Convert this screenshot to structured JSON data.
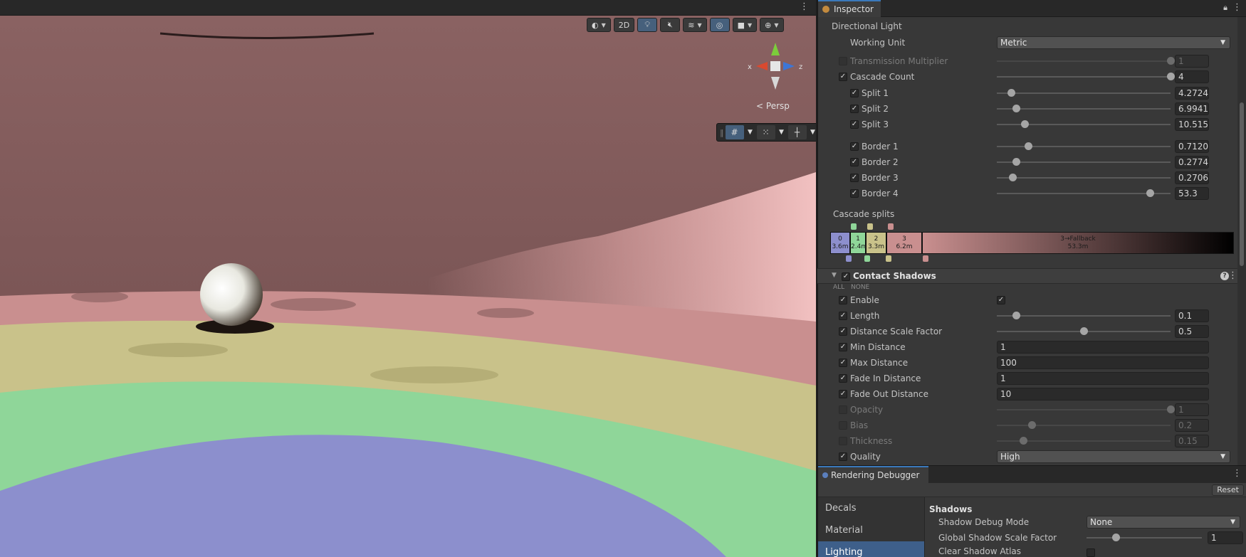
{
  "scene": {
    "toolbar": {
      "draw_mode_icon": "shading-sphere-icon",
      "mode_2d": "2D",
      "lighting_icon": "bulb-icon",
      "audio_icon": "audio-mute-icon",
      "effects_icon": "layers-icon",
      "visibility_icon": "eye-hidden-icon",
      "camera_icon": "camera-icon",
      "gizmos_icon": "globe-icon"
    },
    "gizmo": {
      "x_label": "x",
      "z_label": "z"
    },
    "persp_label": "Persp",
    "colors": {
      "red_band": "#c98f8f",
      "yellow_band": "#c9c28a",
      "green_band": "#8fd699",
      "blue_band": "#8c8fcd"
    }
  },
  "inspector": {
    "tab_title": "Inspector",
    "section_title": "Directional Light",
    "working_unit": {
      "label": "Working Unit",
      "value": "Metric"
    },
    "transmission_multiplier": {
      "label": "Transmission  Multiplier",
      "value": "1",
      "fraction": 1.0
    },
    "cascade_count": {
      "label": "Cascade Count",
      "value": "4",
      "fraction": 1.0
    },
    "splits": [
      {
        "label": "Split 1",
        "value": "4.2724",
        "fraction": 0.08
      },
      {
        "label": "Split 2",
        "value": "6.99419",
        "fraction": 0.11
      },
      {
        "label": "Split 3",
        "value": "10.5154",
        "fraction": 0.16
      }
    ],
    "borders": [
      {
        "label": "Border 1",
        "value": "0.71206",
        "fraction": 0.18
      },
      {
        "label": "Border 2",
        "value": "0.27743",
        "fraction": 0.11
      },
      {
        "label": "Border 3",
        "value": "0.27067",
        "fraction": 0.09
      },
      {
        "label": "Border 4",
        "value": "53.3",
        "fraction": 0.88
      }
    ],
    "cascade_splits": {
      "label": "Cascade splits",
      "segments": [
        {
          "index": "0",
          "distance": "3.6m",
          "color": "#8d8fcd"
        },
        {
          "index": "1",
          "distance": "2.4m",
          "color": "#8fd699"
        },
        {
          "index": "2",
          "distance": "3.3m",
          "color": "#c9c28a"
        },
        {
          "index": "3",
          "distance": "6.2m",
          "color": "#c98f8f"
        },
        {
          "index": "3→Fallback",
          "distance": "53.3m",
          "color": "#c98f8f"
        }
      ]
    },
    "contact_shadows": {
      "title": "Contact Shadows",
      "all_label": "ALL",
      "none_label": "NONE",
      "enable": {
        "label": "Enable"
      },
      "length": {
        "label": "Length",
        "value": "0.1",
        "fraction": 0.11
      },
      "distance_scale_factor": {
        "label": "Distance Scale Factor",
        "value": "0.5",
        "fraction": 0.5
      },
      "min_distance": {
        "label": "Min Distance",
        "value": "1"
      },
      "max_distance": {
        "label": "Max Distance",
        "value": "100"
      },
      "fade_in_distance": {
        "label": "Fade In Distance",
        "value": "1"
      },
      "fade_out_distance": {
        "label": "Fade Out Distance",
        "value": "10"
      },
      "opacity": {
        "label": "Opacity",
        "value": "1",
        "fraction": 1.0
      },
      "bias": {
        "label": "Bias",
        "value": "0.2",
        "fraction": 0.2
      },
      "thickness": {
        "label": "Thickness",
        "value": "0.15",
        "fraction": 0.15
      },
      "quality": {
        "label": "Quality",
        "value": "High"
      }
    }
  },
  "debugger": {
    "tab_title": "Rendering Debugger",
    "reset_label": "Reset",
    "sidebar": [
      "Decals",
      "Material",
      "Lighting"
    ],
    "selected": "Lighting",
    "section": "Shadows",
    "shadow_debug_mode": {
      "label": "Shadow Debug Mode",
      "value": "None"
    },
    "global_shadow_scale_factor": {
      "label": "Global Shadow Scale Factor",
      "value": "1",
      "fraction": 0.25
    },
    "clear_shadow_atlas": {
      "label": "Clear Shadow Atlas"
    }
  }
}
